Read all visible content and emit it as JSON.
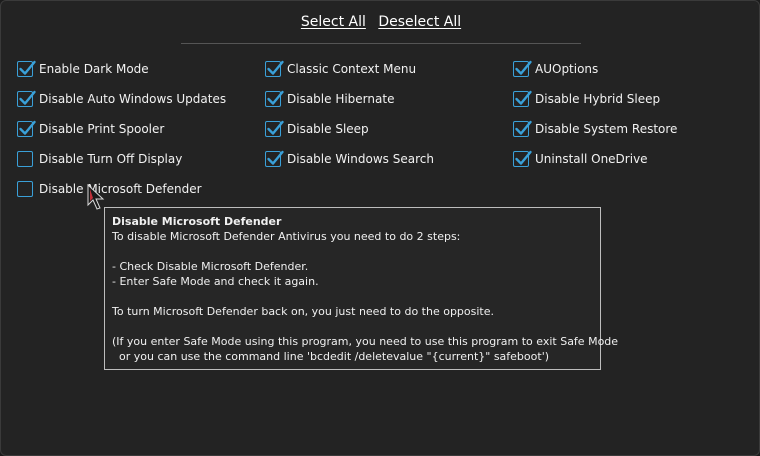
{
  "header": {
    "select_all": "Select All",
    "deselect_all": "Deselect All"
  },
  "options": [
    {
      "label": "Enable Dark Mode",
      "checked": true
    },
    {
      "label": "Classic Context Menu",
      "checked": true
    },
    {
      "label": "AUOptions",
      "checked": true
    },
    {
      "label": "Disable Auto Windows Updates",
      "checked": true
    },
    {
      "label": "Disable Hibernate",
      "checked": true
    },
    {
      "label": "Disable Hybrid Sleep",
      "checked": true
    },
    {
      "label": "Disable Print Spooler",
      "checked": true
    },
    {
      "label": "Disable Sleep",
      "checked": true
    },
    {
      "label": "Disable System Restore",
      "checked": true
    },
    {
      "label": "Disable Turn Off Display",
      "checked": false
    },
    {
      "label": "Disable Windows Search",
      "checked": true
    },
    {
      "label": "Uninstall OneDrive",
      "checked": true
    },
    {
      "label": "Disable Microsoft Defender",
      "checked": false
    }
  ],
  "tooltip": {
    "title": "Disable Microsoft Defender",
    "line1": "To disable Microsoft Defender Antivirus you need to do 2 steps:",
    "step1": "- Check Disable Microsoft Defender.",
    "step2": "- Enter Safe Mode and check it again.",
    "line2": "To turn Microsoft Defender back on, you just need to do the opposite.",
    "note1": "(If you enter Safe Mode using this program, you need to use this program to exit Safe Mode",
    "note2": "  or you can use the command line 'bcdedit /deletevalue \"{current}\" safeboot')"
  },
  "colors": {
    "accent": "#3aa0d8",
    "background": "#232323",
    "text": "#f2f2f2"
  }
}
